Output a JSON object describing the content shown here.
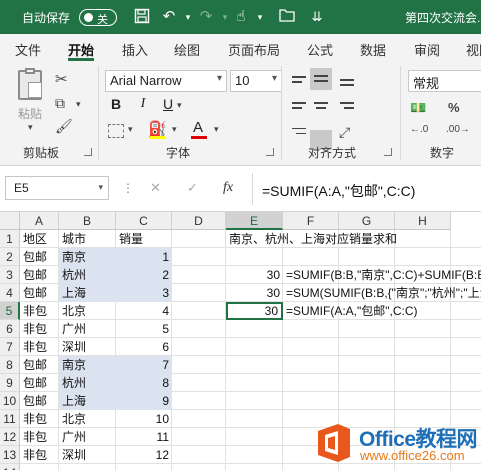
{
  "titlebar": {
    "autosave_label": "自动保存",
    "autosave_state": "关",
    "doc_title": "第四次交流会..."
  },
  "ribbon_tabs": [
    "文件",
    "开始",
    "插入",
    "绘图",
    "页面布局",
    "公式",
    "数据",
    "审阅",
    "视图"
  ],
  "active_tab": "开始",
  "clipboard": {
    "paste_label": "粘贴",
    "group_label": "剪贴板"
  },
  "font": {
    "name": "Arial Narrow",
    "size": "10",
    "bold": "B",
    "italic": "I",
    "underline": "U",
    "font_color": "A",
    "group_label": "字体"
  },
  "alignment": {
    "group_label": "对齐方式"
  },
  "number": {
    "format": "常规",
    "group_label": "数字"
  },
  "formula_bar": {
    "cell_ref": "E5",
    "cancel": "✕",
    "enter": "✓",
    "fx": "fx",
    "formula": "=SUMIF(A:A,\"包邮\",C:C)"
  },
  "columns": [
    "A",
    "B",
    "C",
    "D",
    "E",
    "F",
    "G",
    "H"
  ],
  "rows": [
    "1",
    "2",
    "3",
    "4",
    "5",
    "6",
    "7",
    "8",
    "9",
    "10",
    "11",
    "12",
    "13",
    "14"
  ],
  "cells": {
    "A1": "地区",
    "B1": "城市",
    "C1": "销量",
    "A2": "包邮",
    "B2": "南京",
    "C2": "1",
    "A3": "包邮",
    "B3": "杭州",
    "C3": "2",
    "A4": "包邮",
    "B4": "上海",
    "C4": "3",
    "A5": "非包",
    "B5": "北京",
    "C5": "4",
    "A6": "非包",
    "B6": "广州",
    "C6": "5",
    "A7": "非包",
    "B7": "深圳",
    "C7": "6",
    "A8": "包邮",
    "B8": "南京",
    "C8": "7",
    "A9": "包邮",
    "B9": "杭州",
    "C9": "8",
    "A10": "包邮",
    "B10": "上海",
    "C10": "9",
    "A11": "非包",
    "B11": "北京",
    "C11": "10",
    "A12": "非包",
    "B12": "广州",
    "C12": "11",
    "A13": "非包",
    "B13": "深圳",
    "C13": "12",
    "E1": "南京、杭州、上海对应销量求和",
    "E3": "30",
    "F3": "=SUMIF(B:B,\"南京\",C:C)+SUMIF(B:B,\"杭州\",C:C)",
    "E4": "30",
    "F4": "=SUM(SUMIF(B:B,{\"南京\";\"杭州\";\"上海\"},C:C))",
    "E5": "30",
    "F5": "=SUMIF(A:A,\"包邮\",C:C)"
  },
  "selected_cell": "E5",
  "highlight_color": "#dae3ef",
  "accent_color": "#217346",
  "watermark": {
    "line1": "Office教程网",
    "line2": "www.office26.com"
  }
}
